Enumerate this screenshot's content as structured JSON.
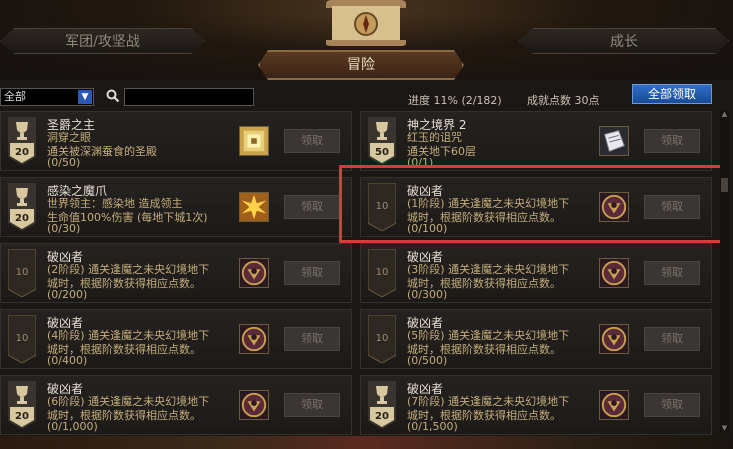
{
  "header": {
    "tab_left": "军团/攻坚战",
    "tab_center": "冒险",
    "tab_right": "成长"
  },
  "toolbar": {
    "filter_value": "全部",
    "search_placeholder": "",
    "progress_label": "进度  11% (2/182)",
    "points_label": "成就点数 30点",
    "claim_all_label": "全部领取"
  },
  "cards": [
    {
      "badge": "20",
      "badge_type": "trophy",
      "title": "圣爵之主",
      "line1": "洞穿之眼",
      "line2": "通关被深渊蚕食的圣殿",
      "progress": "(0/50)",
      "reward_icon": "golden-gem-icon",
      "claim": "领取"
    },
    {
      "badge": "50",
      "badge_type": "trophy",
      "title": "神之境界 2",
      "line1": "红玉的诅咒",
      "line2": "通关地下60层",
      "progress": "(0/1)",
      "reward_icon": "paper-scroll-icon",
      "claim": "领取"
    },
    {
      "badge": "20",
      "badge_type": "trophy",
      "title": "感染之魔爪",
      "line1": "世界领主：感染地        造成领主",
      "line2": "生命值100%伤害 (每地下城1次)",
      "progress": "(0/30)",
      "reward_icon": "starburst-icon",
      "claim": "领取"
    },
    {
      "badge": "10",
      "badge_type": "plain",
      "title": "破凶者",
      "line1": "(1阶段) 通关逢魔之未央幻境地下",
      "line2": "城时，根据阶数获得相应点数。",
      "progress": "(0/100)",
      "reward_icon": "demon-emblem-icon",
      "claim": "领取"
    },
    {
      "badge": "10",
      "badge_type": "plain",
      "title": "破凶者",
      "line1": "(2阶段) 通关逢魔之未央幻境地下",
      "line2": "城时，根据阶数获得相应点数。",
      "progress": "(0/200)",
      "reward_icon": "demon-emblem-icon",
      "claim": "领取"
    },
    {
      "badge": "10",
      "badge_type": "plain",
      "title": "破凶者",
      "line1": "(3阶段) 通关逢魔之未央幻境地下",
      "line2": "城时，根据阶数获得相应点数。",
      "progress": "(0/300)",
      "reward_icon": "demon-emblem-icon",
      "claim": "领取"
    },
    {
      "badge": "10",
      "badge_type": "plain",
      "title": "破凶者",
      "line1": "(4阶段) 通关逢魔之未央幻境地下",
      "line2": "城时，根据阶数获得相应点数。",
      "progress": "(0/400)",
      "reward_icon": "demon-emblem-icon",
      "claim": "领取"
    },
    {
      "badge": "10",
      "badge_type": "plain",
      "title": "破凶者",
      "line1": "(5阶段) 通关逢魔之未央幻境地下",
      "line2": "城时，根据阶数获得相应点数。",
      "progress": "(0/500)",
      "reward_icon": "demon-emblem-icon",
      "claim": "领取"
    },
    {
      "badge": "20",
      "badge_type": "trophy",
      "title": "破凶者",
      "line1": "(6阶段) 通关逢魔之未央幻境地下",
      "line2": "城时，根据阶数获得相应点数。",
      "progress": "(0/1,000)",
      "reward_icon": "demon-emblem-icon",
      "claim": "领取"
    },
    {
      "badge": "20",
      "badge_type": "trophy",
      "title": "破凶者",
      "line1": "(7阶段) 通关逢魔之未央幻境地下",
      "line2": "城时，根据阶数获得相应点数。",
      "progress": "(0/1,500)",
      "reward_icon": "demon-emblem-icon",
      "claim": "领取"
    }
  ],
  "colors": {
    "accent_blue": "#2f6fc8",
    "highlight_red": "#d63c3c",
    "desc_gold": "#c3ad7a"
  }
}
